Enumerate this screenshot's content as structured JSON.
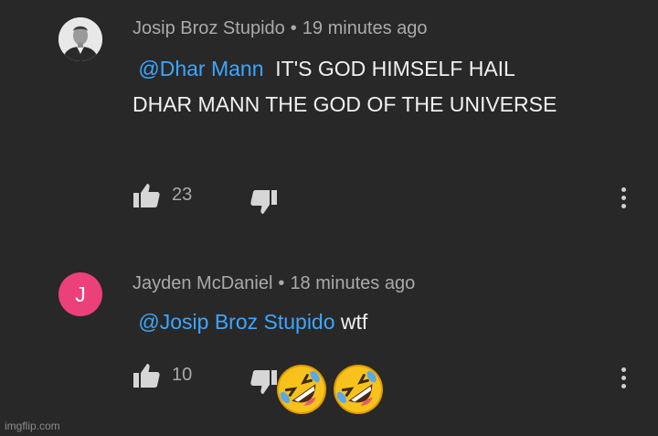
{
  "comments": [
    {
      "author": "Josip Broz Stupido",
      "separator": "•",
      "time": "19 minutes ago",
      "mention": "@Dhar Mann",
      "text": "IT'S GOD HIMSELF HAIL DHAR MANN THE GOD OF THE UNIVERSE",
      "likes": "23"
    },
    {
      "author": "Jayden McDaniel",
      "separator": "•",
      "time": "18 minutes ago",
      "avatar_letter": "J",
      "mention": "@Josip Broz Stupido",
      "text": "wtf",
      "likes": "10"
    }
  ],
  "stickers": [
    "rolling-on-floor-laughing",
    "rolling-on-floor-laughing"
  ],
  "colors": {
    "background": "#282828",
    "mention": "#3ea6ff",
    "avatar_j": "#ec407a",
    "meta": "#aaaaaa"
  },
  "watermark": "imgflip.com"
}
